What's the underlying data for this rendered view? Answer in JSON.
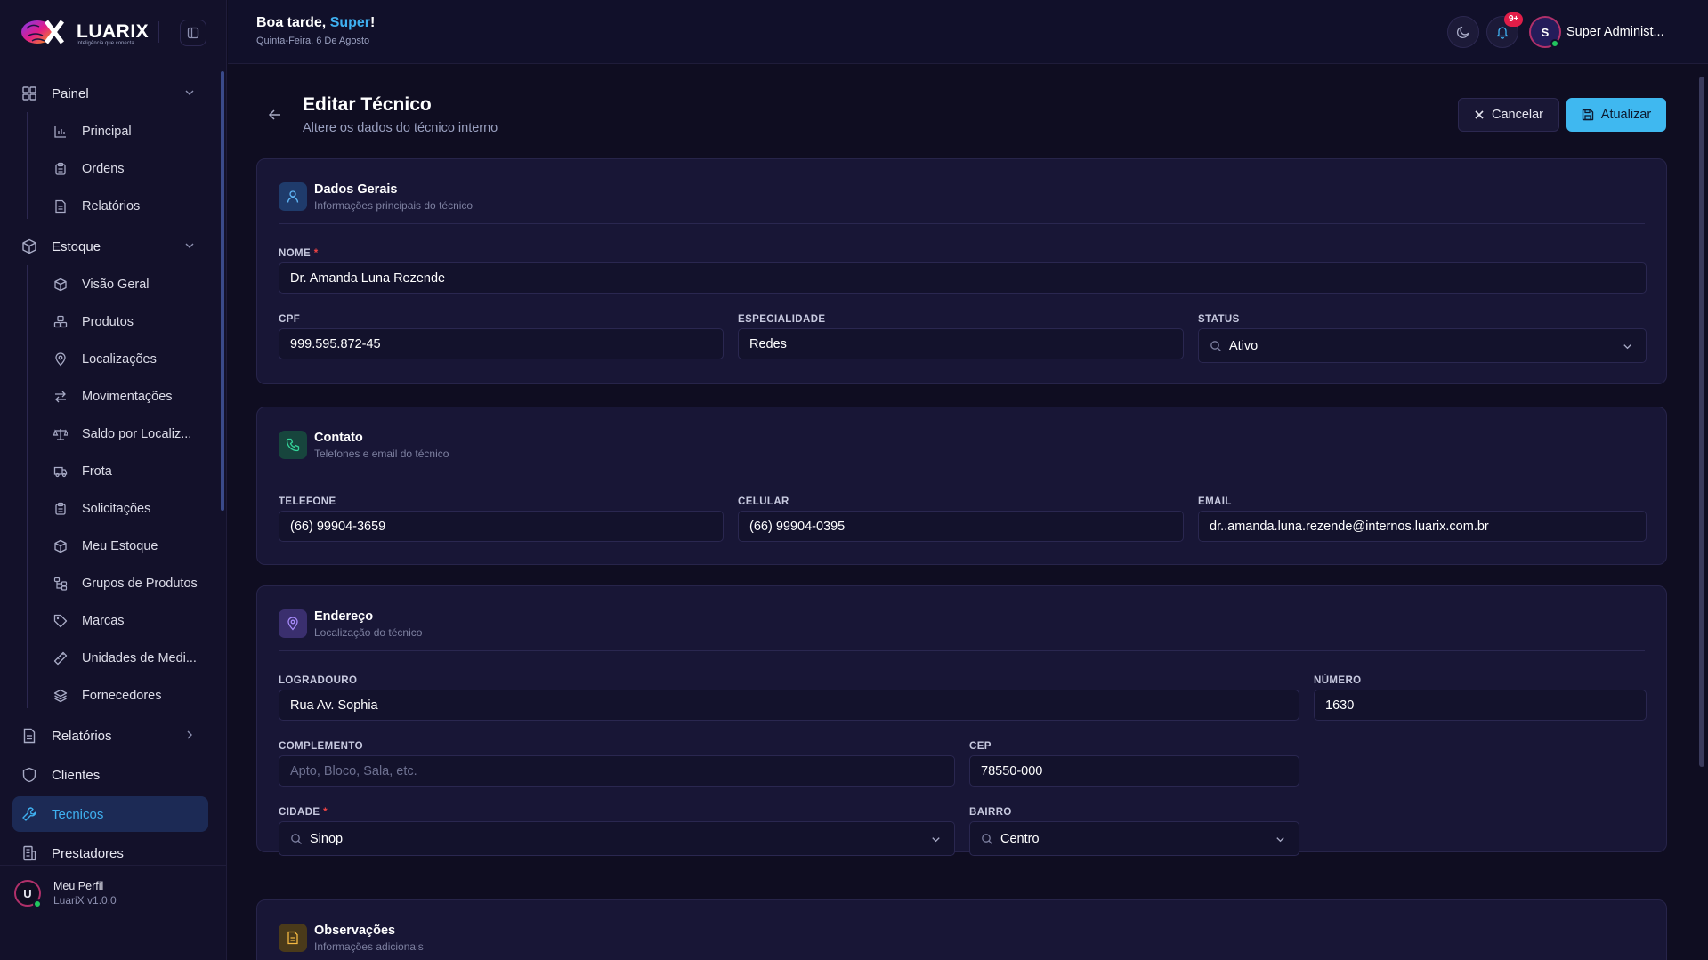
{
  "brand": {
    "name": "LUARIX",
    "tagline": "Inteligência que conecta"
  },
  "header": {
    "greeting_prefix": "Boa tarde, ",
    "greeting_name": "Super",
    "greeting_suffix": "!",
    "date": "Quinta-Feira, 6 De Agosto",
    "notifications_badge": "9+",
    "user_initial": "S",
    "user_name": "Super Administ..."
  },
  "sidebar": {
    "groups": [
      {
        "label": "Painel",
        "icon": "dashboard-icon",
        "items": [
          {
            "label": "Principal",
            "icon": "bar-chart-icon"
          },
          {
            "label": "Ordens",
            "icon": "clipboard-icon"
          },
          {
            "label": "Relatórios",
            "icon": "document-icon"
          }
        ]
      },
      {
        "label": "Estoque",
        "icon": "box-icon",
        "items": [
          {
            "label": "Visão Geral",
            "icon": "box-icon"
          },
          {
            "label": "Produtos",
            "icon": "boxes-icon"
          },
          {
            "label": "Localizações",
            "icon": "map-pin-icon"
          },
          {
            "label": "Movimentações",
            "icon": "arrows-icon"
          },
          {
            "label": "Saldo por Localiz...",
            "icon": "scale-icon"
          },
          {
            "label": "Frota",
            "icon": "truck-icon"
          },
          {
            "label": "Solicitações",
            "icon": "clipboard-icon"
          },
          {
            "label": "Meu Estoque",
            "icon": "box-icon"
          },
          {
            "label": "Grupos de Produtos",
            "icon": "network-icon"
          },
          {
            "label": "Marcas",
            "icon": "tag-icon"
          },
          {
            "label": "Unidades de Medi...",
            "icon": "ruler-icon"
          },
          {
            "label": "Fornecedores",
            "icon": "layers-icon"
          }
        ]
      }
    ],
    "relatorios": "Relatórios",
    "clientes": "Clientes",
    "tecnicos": "Tecnicos",
    "prestadores": "Prestadores",
    "profile_name": "Meu Perfil",
    "profile_version": "LuariX v1.0.0",
    "profile_initial": "U"
  },
  "page": {
    "title": "Editar Técnico",
    "subtitle": "Altere os dados do técnico interno",
    "cancel_label": "Cancelar",
    "update_label": "Atualizar"
  },
  "dados_gerais": {
    "title": "Dados Gerais",
    "subtitle": "Informações principais do técnico",
    "nome_label": "NOME",
    "nome_value": "Dr. Amanda Luna Rezende",
    "cpf_label": "CPF",
    "cpf_value": "999.595.872-45",
    "especialidade_label": "ESPECIALIDADE",
    "especialidade_value": "Redes",
    "status_label": "STATUS",
    "status_value": "Ativo"
  },
  "contato": {
    "title": "Contato",
    "subtitle": "Telefones e email do técnico",
    "telefone_label": "TELEFONE",
    "telefone_value": "(66) 99904-3659",
    "celular_label": "CELULAR",
    "celular_value": "(66) 99904-0395",
    "email_label": "EMAIL",
    "email_value": "dr..amanda.luna.rezende@internos.luarix.com.br"
  },
  "endereco": {
    "title": "Endereço",
    "subtitle": "Localização do técnico",
    "logradouro_label": "LOGRADOURO",
    "logradouro_value": "Rua Av. Sophia",
    "numero_label": "NÚMERO",
    "numero_value": "1630",
    "complemento_label": "COMPLEMENTO",
    "complemento_placeholder": "Apto, Bloco, Sala, etc.",
    "cep_label": "CEP",
    "cep_value": "78550-000",
    "cidade_label": "CIDADE",
    "cidade_value": "Sinop",
    "bairro_label": "BAIRRO",
    "bairro_value": "Centro"
  },
  "observacoes": {
    "title": "Observações",
    "subtitle": "Informações adicionais"
  },
  "colors": {
    "accent": "#3fb8f0",
    "background": "#0f0d21",
    "card": "#181636",
    "badge": "#e11d48",
    "online": "#22c55e"
  }
}
